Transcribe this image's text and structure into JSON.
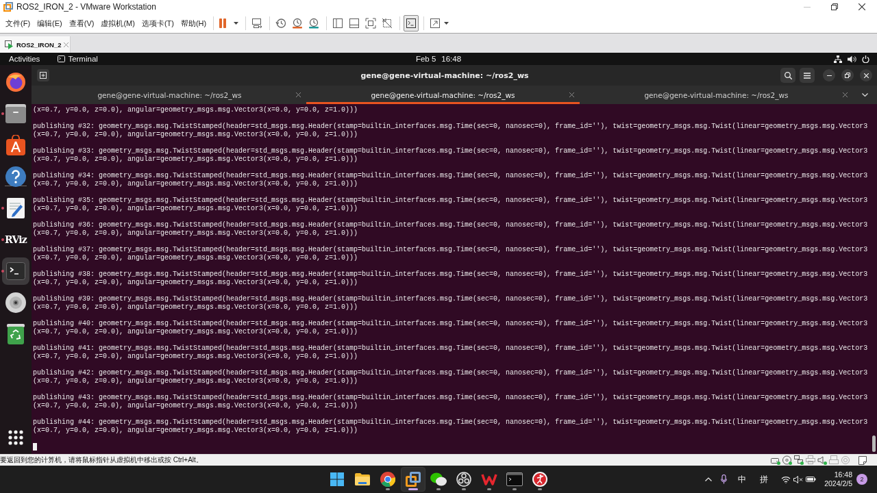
{
  "window": {
    "title": "ROS2_IRON_2 - VMware Workstation"
  },
  "menu": [
    "文件(F)",
    "编辑(E)",
    "查看(V)",
    "虚拟机(M)",
    "选项卡(T)",
    "帮助(H)"
  ],
  "toolbar": [
    {
      "items": [
        {
          "kind": "pause",
          "selected": false,
          "dropdown": true
        }
      ]
    },
    {
      "items": [
        {
          "kind": "keys",
          "selected": false,
          "dropdown": false
        }
      ]
    },
    {
      "items": [
        {
          "kind": "snapshot",
          "selected": false,
          "dropdown": false
        },
        {
          "kind": "revert",
          "selected": false,
          "dropdown": false
        },
        {
          "kind": "manager",
          "selected": false,
          "dropdown": false
        }
      ]
    },
    {
      "items": [
        {
          "kind": "sidebar",
          "selected": false,
          "dropdown": false
        },
        {
          "kind": "thumbnails",
          "selected": false,
          "dropdown": false
        },
        {
          "kind": "fullscreen",
          "selected": false,
          "dropdown": false
        },
        {
          "kind": "unity",
          "selected": false,
          "dropdown": false
        }
      ]
    },
    {
      "items": [
        {
          "kind": "console",
          "selected": true,
          "dropdown": false
        }
      ]
    },
    {
      "items": [
        {
          "kind": "stretch",
          "selected": false,
          "dropdown": true
        }
      ]
    }
  ],
  "vm_tabs": [
    {
      "label": "ROS2_IRON_2",
      "selected": true
    }
  ],
  "top_bar": {
    "activities": "Activities",
    "app": "Terminal",
    "date": "Feb 5",
    "time": "16:48"
  },
  "dock": [
    {
      "items": [
        {
          "kind": "browser",
          "running": false,
          "selected": false
        },
        {
          "kind": "files",
          "running": true,
          "selected": false
        },
        {
          "kind": "store",
          "running": false,
          "selected": false
        },
        {
          "kind": "help",
          "running": false,
          "selected": false
        }
      ]
    },
    {
      "items": [
        {
          "kind": "editor",
          "running": true,
          "selected": false
        },
        {
          "kind": "logo",
          "label": "RViz",
          "running": true,
          "selected": false
        },
        {
          "kind": "terminal",
          "running": true,
          "selected": true
        },
        {
          "kind": "disc",
          "running": false,
          "selected": false
        },
        {
          "kind": "trash",
          "running": false,
          "selected": false
        }
      ]
    }
  ],
  "terminal": {
    "title": "gene@gene-virtual-machine: ~/ros2_ws",
    "tabs": [
      {
        "label": "gene@gene-virtual-machine: ~/ros2_ws",
        "selected": false
      },
      {
        "label": "gene@gene-virtual-machine: ~/ros2_ws",
        "selected": true
      },
      {
        "label": "gene@gene-virtual-machine: ~/ros2_ws",
        "selected": false
      }
    ],
    "output": [
      {
        "lines": [
          "(x=0.7, y=0.0, z=0.0), angular=geometry_msgs.msg.Vector3(x=0.0, y=0.0, z=1.0)))"
        ]
      },
      {
        "lines": [
          "publishing #32: geometry_msgs.msg.TwistStamped(header=std_msgs.msg.Header(stamp=builtin_interfaces.msg.Time(sec=0, nanosec=0), frame_id=''), twist=geometry_msgs.msg.Twist(linear=geometry_msgs.msg.Vector3",
          "(x=0.7, y=0.0, z=0.0), angular=geometry_msgs.msg.Vector3(x=0.0, y=0.0, z=1.0)))"
        ]
      },
      {
        "lines": [
          "publishing #33: geometry_msgs.msg.TwistStamped(header=std_msgs.msg.Header(stamp=builtin_interfaces.msg.Time(sec=0, nanosec=0), frame_id=''), twist=geometry_msgs.msg.Twist(linear=geometry_msgs.msg.Vector3",
          "(x=0.7, y=0.0, z=0.0), angular=geometry_msgs.msg.Vector3(x=0.0, y=0.0, z=1.0)))"
        ]
      },
      {
        "lines": [
          "publishing #34: geometry_msgs.msg.TwistStamped(header=std_msgs.msg.Header(stamp=builtin_interfaces.msg.Time(sec=0, nanosec=0), frame_id=''), twist=geometry_msgs.msg.Twist(linear=geometry_msgs.msg.Vector3",
          "(x=0.7, y=0.0, z=0.0), angular=geometry_msgs.msg.Vector3(x=0.0, y=0.0, z=1.0)))"
        ]
      },
      {
        "lines": [
          "publishing #35: geometry_msgs.msg.TwistStamped(header=std_msgs.msg.Header(stamp=builtin_interfaces.msg.Time(sec=0, nanosec=0), frame_id=''), twist=geometry_msgs.msg.Twist(linear=geometry_msgs.msg.Vector3",
          "(x=0.7, y=0.0, z=0.0), angular=geometry_msgs.msg.Vector3(x=0.0, y=0.0, z=1.0)))"
        ]
      },
      {
        "lines": [
          "publishing #36: geometry_msgs.msg.TwistStamped(header=std_msgs.msg.Header(stamp=builtin_interfaces.msg.Time(sec=0, nanosec=0), frame_id=''), twist=geometry_msgs.msg.Twist(linear=geometry_msgs.msg.Vector3",
          "(x=0.7, y=0.0, z=0.0), angular=geometry_msgs.msg.Vector3(x=0.0, y=0.0, z=1.0)))"
        ]
      },
      {
        "lines": [
          "publishing #37: geometry_msgs.msg.TwistStamped(header=std_msgs.msg.Header(stamp=builtin_interfaces.msg.Time(sec=0, nanosec=0), frame_id=''), twist=geometry_msgs.msg.Twist(linear=geometry_msgs.msg.Vector3",
          "(x=0.7, y=0.0, z=0.0), angular=geometry_msgs.msg.Vector3(x=0.0, y=0.0, z=1.0)))"
        ]
      },
      {
        "lines": [
          "publishing #38: geometry_msgs.msg.TwistStamped(header=std_msgs.msg.Header(stamp=builtin_interfaces.msg.Time(sec=0, nanosec=0), frame_id=''), twist=geometry_msgs.msg.Twist(linear=geometry_msgs.msg.Vector3",
          "(x=0.7, y=0.0, z=0.0), angular=geometry_msgs.msg.Vector3(x=0.0, y=0.0, z=1.0)))"
        ]
      },
      {
        "lines": [
          "publishing #39: geometry_msgs.msg.TwistStamped(header=std_msgs.msg.Header(stamp=builtin_interfaces.msg.Time(sec=0, nanosec=0), frame_id=''), twist=geometry_msgs.msg.Twist(linear=geometry_msgs.msg.Vector3",
          "(x=0.7, y=0.0, z=0.0), angular=geometry_msgs.msg.Vector3(x=0.0, y=0.0, z=1.0)))"
        ]
      },
      {
        "lines": [
          "publishing #40: geometry_msgs.msg.TwistStamped(header=std_msgs.msg.Header(stamp=builtin_interfaces.msg.Time(sec=0, nanosec=0), frame_id=''), twist=geometry_msgs.msg.Twist(linear=geometry_msgs.msg.Vector3",
          "(x=0.7, y=0.0, z=0.0), angular=geometry_msgs.msg.Vector3(x=0.0, y=0.0, z=1.0)))"
        ]
      },
      {
        "lines": [
          "publishing #41: geometry_msgs.msg.TwistStamped(header=std_msgs.msg.Header(stamp=builtin_interfaces.msg.Time(sec=0, nanosec=0), frame_id=''), twist=geometry_msgs.msg.Twist(linear=geometry_msgs.msg.Vector3",
          "(x=0.7, y=0.0, z=0.0), angular=geometry_msgs.msg.Vector3(x=0.0, y=0.0, z=1.0)))"
        ]
      },
      {
        "lines": [
          "publishing #42: geometry_msgs.msg.TwistStamped(header=std_msgs.msg.Header(stamp=builtin_interfaces.msg.Time(sec=0, nanosec=0), frame_id=''), twist=geometry_msgs.msg.Twist(linear=geometry_msgs.msg.Vector3",
          "(x=0.7, y=0.0, z=0.0), angular=geometry_msgs.msg.Vector3(x=0.0, y=0.0, z=1.0)))"
        ]
      },
      {
        "lines": [
          "publishing #43: geometry_msgs.msg.TwistStamped(header=std_msgs.msg.Header(stamp=builtin_interfaces.msg.Time(sec=0, nanosec=0), frame_id=''), twist=geometry_msgs.msg.Twist(linear=geometry_msgs.msg.Vector3",
          "(x=0.7, y=0.0, z=0.0), angular=geometry_msgs.msg.Vector3(x=0.0, y=0.0, z=1.0)))"
        ]
      },
      {
        "lines": [
          "publishing #44: geometry_msgs.msg.TwistStamped(header=std_msgs.msg.Header(stamp=builtin_interfaces.msg.Time(sec=0, nanosec=0), frame_id=''), twist=geometry_msgs.msg.Twist(linear=geometry_msgs.msg.Vector3",
          "(x=0.7, y=0.0, z=0.0), angular=geometry_msgs.msg.Vector3(x=0.0, y=0.0, z=1.0)))"
        ]
      }
    ]
  },
  "status_bar": {
    "message": "要返回到您的计算机，请将鼠标指针从虚拟机中移出或按 Ctrl+Alt。",
    "devices": [
      {
        "kind": "drive",
        "active": true
      },
      {
        "kind": "disc",
        "active": true
      },
      {
        "kind": "network",
        "active": true
      },
      {
        "kind": "printer",
        "active": false
      },
      {
        "kind": "sound",
        "active": true
      },
      {
        "kind": "usb",
        "active": false
      },
      {
        "kind": "camera",
        "active": false
      }
    ]
  },
  "taskbar": {
    "apps": [
      {
        "kind": "start",
        "running": false,
        "selected": false
      },
      {
        "kind": "folder",
        "running": false,
        "selected": false
      },
      {
        "kind": "browser",
        "running": true,
        "selected": false
      },
      {
        "kind": "vm",
        "running": true,
        "selected": true
      },
      {
        "kind": "chat",
        "running": true,
        "selected": false
      },
      {
        "kind": "recorder",
        "running": true,
        "selected": false
      },
      {
        "kind": "office",
        "running": true,
        "selected": false
      },
      {
        "kind": "console",
        "running": true,
        "selected": false
      },
      {
        "kind": "media",
        "running": true,
        "selected": false
      }
    ],
    "ime_mode": "中",
    "ime": "拼",
    "time": "16:48",
    "date": "2024/2/5",
    "notifications": "2"
  }
}
